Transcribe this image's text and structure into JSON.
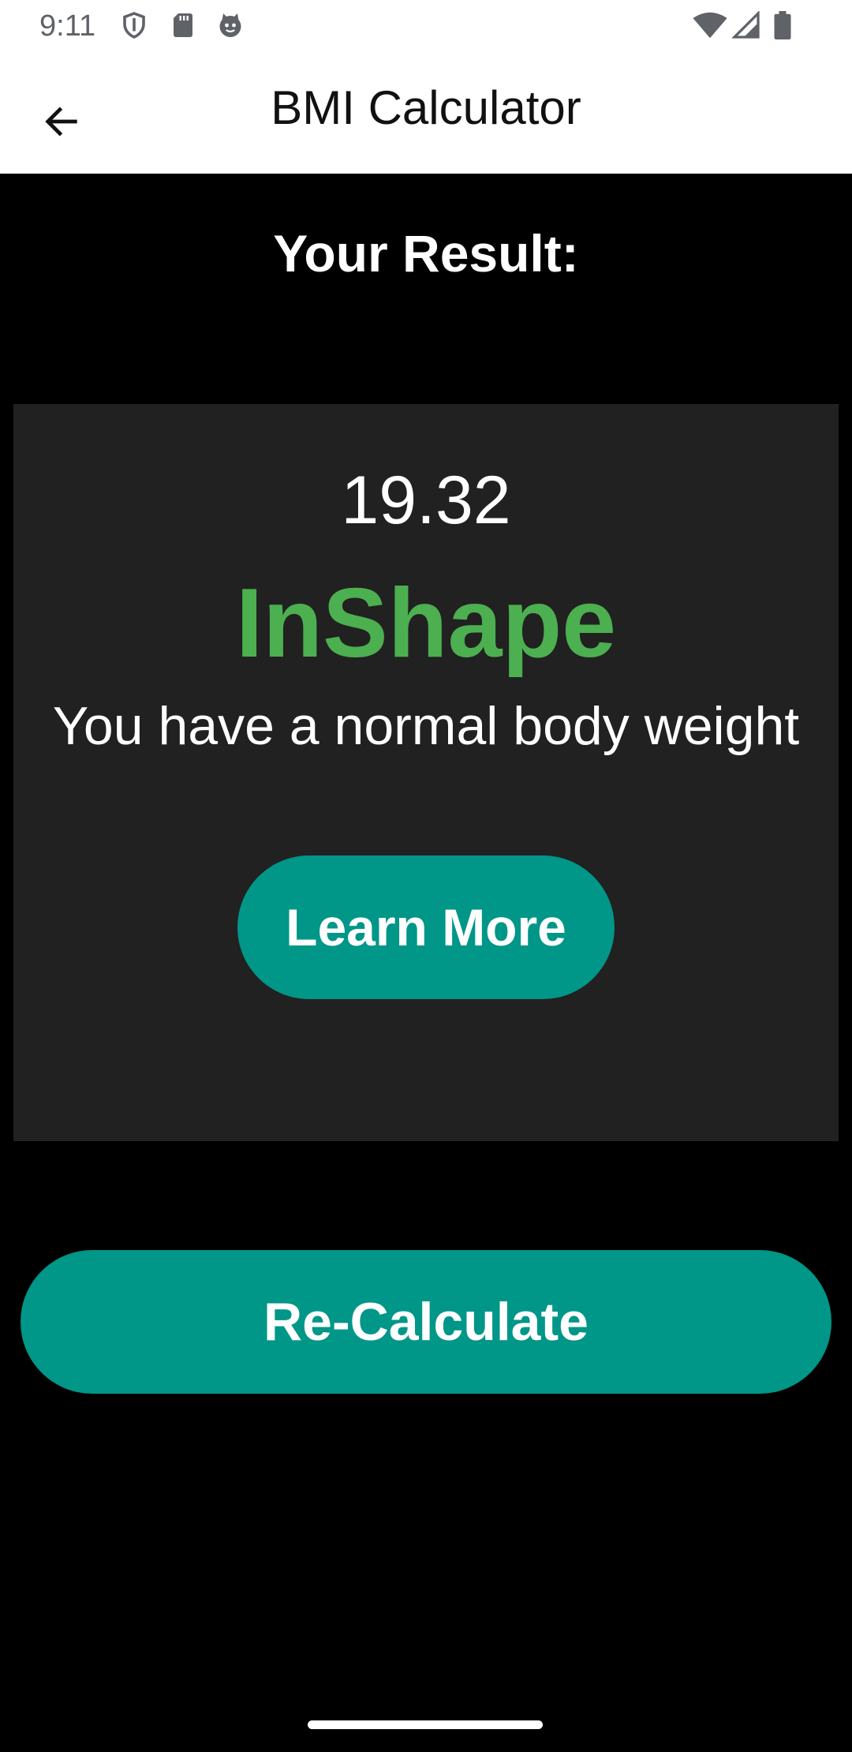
{
  "status_bar": {
    "time": "9:11",
    "left_icons": [
      "shield-icon",
      "sd-card-icon",
      "cat-face-icon"
    ],
    "right_icons": [
      "wifi-icon",
      "signal-icon",
      "battery-icon"
    ]
  },
  "app_bar": {
    "title": "BMI Calculator",
    "back_icon": "arrow-back-icon"
  },
  "result": {
    "heading": "Your Result:",
    "bmi_value": "19.32",
    "category": "InShape",
    "message": "You have a normal body weight",
    "learn_more_label": "Learn More"
  },
  "actions": {
    "recalculate_label": "Re-Calculate"
  },
  "colors": {
    "accent": "#009688",
    "category_green": "#4caf50",
    "card_background": "#212121",
    "background": "#000000"
  }
}
